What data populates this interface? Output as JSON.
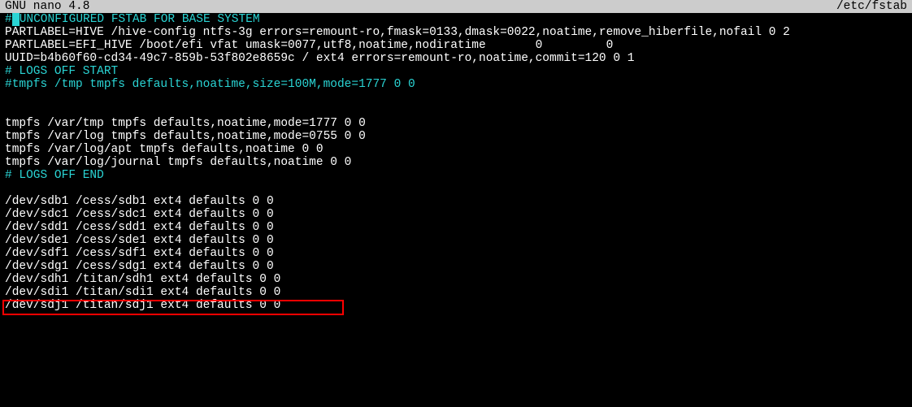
{
  "titlebar": {
    "app": "  GNU nano 4.8",
    "file": "/etc/fstab"
  },
  "lines": {
    "l0_prefix": "#",
    "l0_cursor": " ",
    "l0_rest": "UNCONFIGURED FSTAB FOR BASE SYSTEM",
    "l1": "PARTLABEL=HIVE /hive-config ntfs-3g errors=remount-ro,fmask=0133,dmask=0022,noatime,remove_hiberfile,nofail 0 2",
    "l2": "PARTLABEL=EFI_HIVE /boot/efi vfat umask=0077,utf8,noatime,nodiratime       0         0",
    "l3": "UUID=b4b60f60-cd34-49c7-859b-53f802e8659c / ext4 errors=remount-ro,noatime,commit=120 0 1",
    "l4": "# LOGS OFF START",
    "l5": "#tmpfs /tmp tmpfs defaults,noatime,size=100M,mode=1777 0 0",
    "l6": "",
    "l7": "",
    "l8": "tmpfs /var/tmp tmpfs defaults,noatime,mode=1777 0 0",
    "l9": "tmpfs /var/log tmpfs defaults,noatime,mode=0755 0 0",
    "l10": "tmpfs /var/log/apt tmpfs defaults,noatime 0 0",
    "l11": "tmpfs /var/log/journal tmpfs defaults,noatime 0 0",
    "l12": "# LOGS OFF END",
    "l13": "",
    "l14": "/dev/sdb1 /cess/sdb1 ext4 defaults 0 0",
    "l15": "/dev/sdc1 /cess/sdc1 ext4 defaults 0 0",
    "l16": "/dev/sdd1 /cess/sdd1 ext4 defaults 0 0",
    "l17": "/dev/sde1 /cess/sde1 ext4 defaults 0 0",
    "l18": "/dev/sdf1 /cess/sdf1 ext4 defaults 0 0",
    "l19": "/dev/sdg1 /cess/sdg1 ext4 defaults 0 0",
    "l20": "/dev/sdh1 /titan/sdh1 ext4 defaults 0 0",
    "l21": "/dev/sdi1 /titan/sdi1 ext4 defaults 0 0",
    "l22": "/dev/sdj1 /titan/sdj1 ext4 defaults 0 0"
  }
}
